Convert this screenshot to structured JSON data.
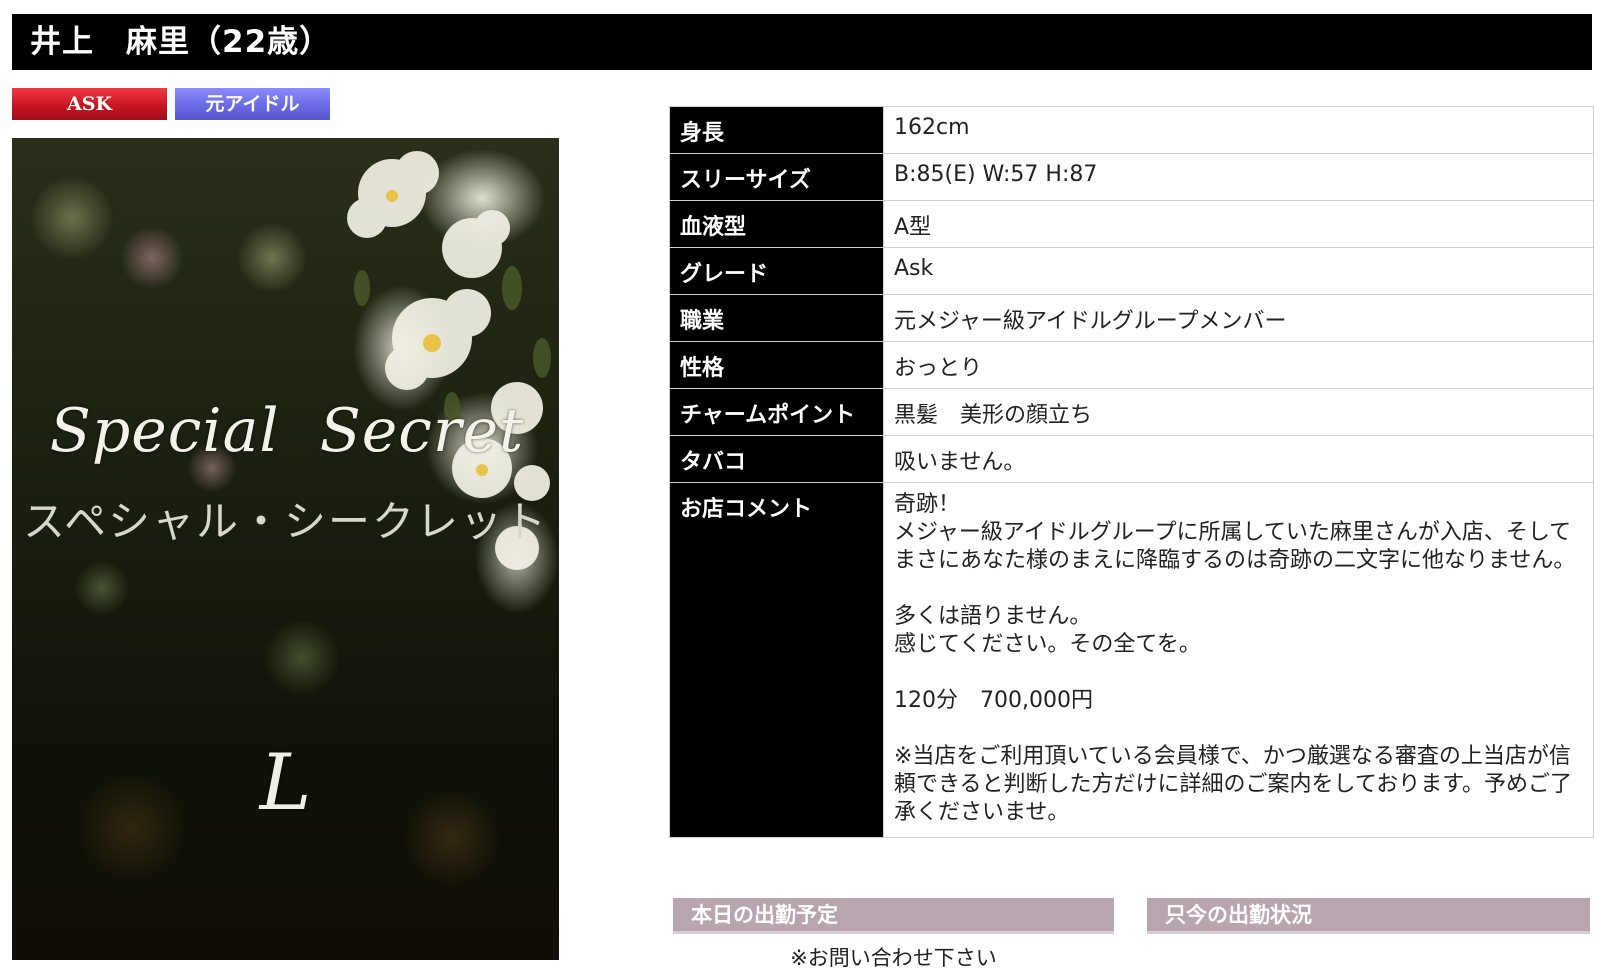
{
  "header": {
    "title": "井上　麻里（22歳）"
  },
  "badges": {
    "ask": "ASK",
    "former_idol": "元アイドル"
  },
  "photo": {
    "title_en": "Special  Secret",
    "title_jp": "スペシャル・シークレット",
    "monogram": "L"
  },
  "profile": {
    "rows": [
      {
        "label": "身長",
        "value": "162cm"
      },
      {
        "label": "スリーサイズ",
        "value": "B:85(E) W:57 H:87"
      },
      {
        "label": "血液型",
        "value": "A型"
      },
      {
        "label": "グレード",
        "value": "Ask"
      },
      {
        "label": "職業",
        "value": "元メジャー級アイドルグループメンバー"
      },
      {
        "label": "性格",
        "value": "おっとり"
      },
      {
        "label": "チャームポイント",
        "value": "黒髪　美形の顔立ち"
      },
      {
        "label": "タバコ",
        "value": "吸いません。"
      }
    ],
    "comment": {
      "label": "お店コメント",
      "text": "奇跡！\nメジャー級アイドルグループに所属していた麻里さんが入店、そしてまさにあなた様のまえに降臨するのは奇跡の二文字に他なりません。\n\n多くは語りません。\n感じてください。その全てを。\n\n120分　700,000円\n\n※当店をご利用頂いている会員様で、かつ厳選なる審査の上当店が信頼できると判断した方だけに詳細のご案内をしております。予めご了承くださいませ。"
    }
  },
  "schedule": {
    "today_label": "本日の出勤予定",
    "now_label": "只今の出勤状況",
    "today_note": "※お問い合わせ下さい"
  }
}
